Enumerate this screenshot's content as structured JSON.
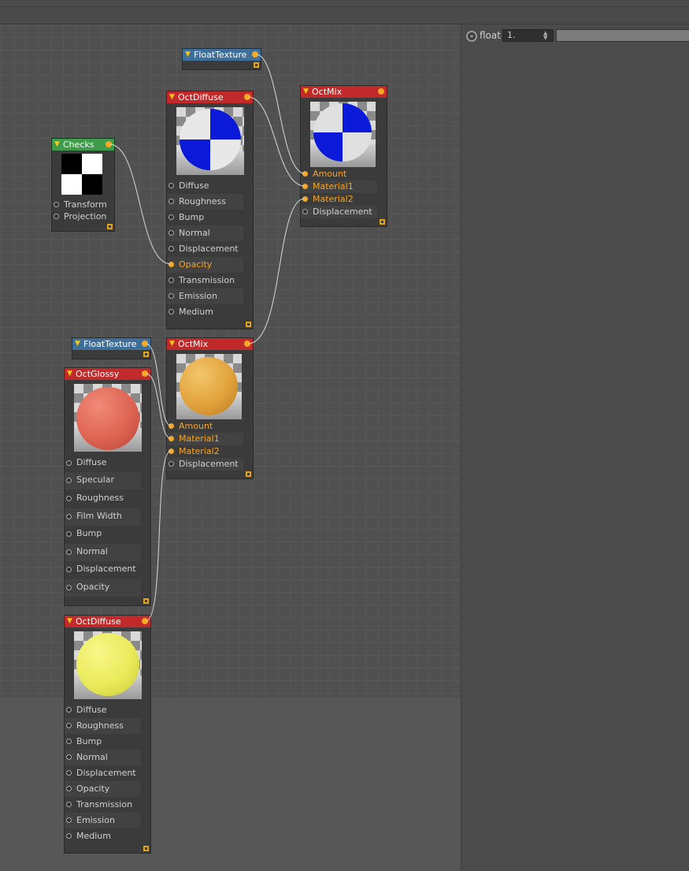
{
  "attributes": {
    "param_label": "float",
    "param_value": "1."
  },
  "nodes": {
    "float_texture_top": {
      "title": "FloatTexture"
    },
    "oct_diffuse_top": {
      "title": "OctDiffuse",
      "ports": [
        "Diffuse",
        "Roughness",
        "Bump",
        "Normal",
        "Displacement",
        "Opacity",
        "Transmission",
        "Emission",
        "Medium"
      ]
    },
    "oct_mix_top": {
      "title": "OctMix",
      "ports": [
        "Amount",
        "Material1",
        "Material2",
        "Displacement"
      ]
    },
    "checks": {
      "title": "Checks",
      "ports": [
        "Transform",
        "Projection"
      ]
    },
    "float_texture_bottom": {
      "title": "FloatTexture"
    },
    "oct_mix_bottom": {
      "title": "OctMix",
      "ports": [
        "Amount",
        "Material1",
        "Material2",
        "Displacement"
      ]
    },
    "oct_glossy": {
      "title": "OctGlossy",
      "ports": [
        "Diffuse",
        "Specular",
        "Roughness",
        "Film Width",
        "Bump",
        "Normal",
        "Displacement",
        "Opacity"
      ]
    },
    "oct_diffuse_bottom": {
      "title": "OctDiffuse",
      "ports": [
        "Diffuse",
        "Roughness",
        "Bump",
        "Normal",
        "Displacement",
        "Opacity",
        "Transmission",
        "Emission",
        "Medium"
      ]
    }
  },
  "colors": {
    "header_red": "#c02a2a",
    "header_blue": "#3e6f9a",
    "header_green": "#3f9c4a",
    "port_active": "#f5a623"
  }
}
